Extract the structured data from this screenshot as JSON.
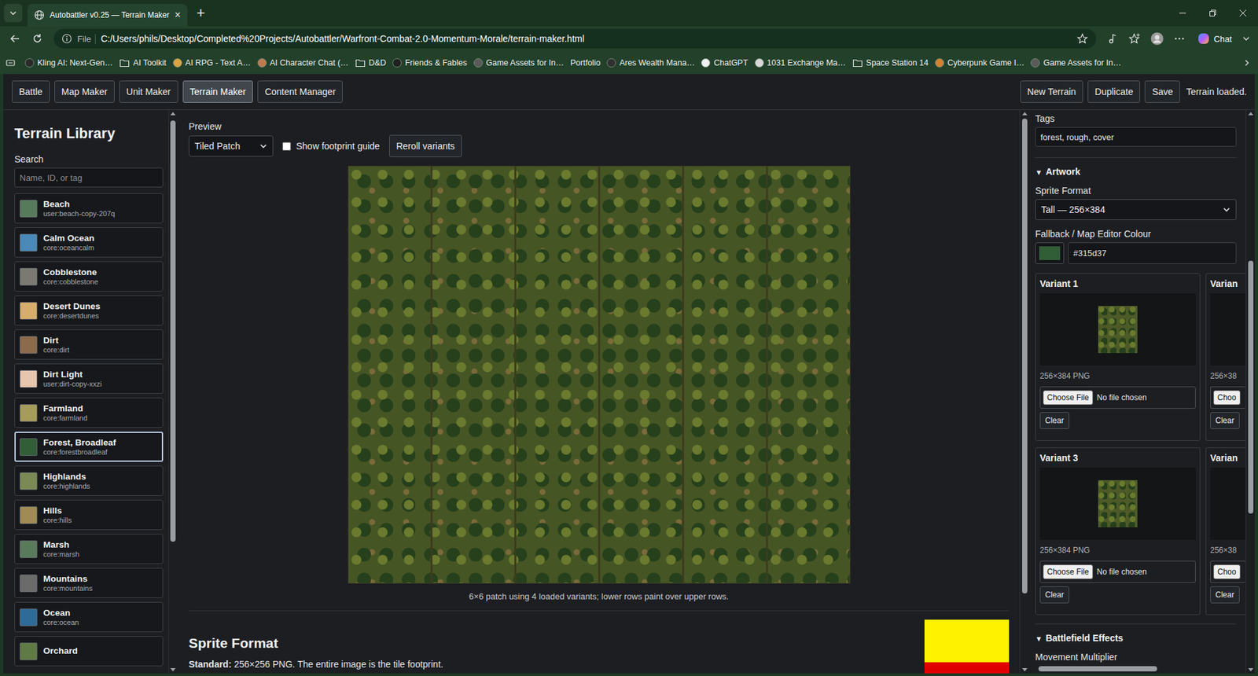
{
  "browser": {
    "tab_title": "Autobattler v0.25 — Terrain Maker",
    "tab_close": "×",
    "new_tab": "+",
    "address_scheme": "File",
    "url": "C:/Users/phils/Desktop/Completed%20Projects/Autobattler/Warfront-Combat-2.0-Momentum-Morale/terrain-maker.html",
    "copilot": "Chat"
  },
  "bookmarks": [
    {
      "label": "Kling AI: Next-Gen…",
      "kind": "site",
      "color": "#2a2a2a"
    },
    {
      "label": "AI Toolkit",
      "kind": "folder"
    },
    {
      "label": "AI RPG - Text A…",
      "kind": "site",
      "color": "#d9a441"
    },
    {
      "label": "AI Character Chat (…",
      "kind": "site",
      "color": "#c07a4e"
    },
    {
      "label": "D&D",
      "kind": "folder"
    },
    {
      "label": "Friends & Fables",
      "kind": "site",
      "color": "#202020"
    },
    {
      "label": "Game Assets for In…",
      "kind": "site",
      "color": "#5a5a5a"
    },
    {
      "label": "Portfolio",
      "kind": "plain"
    },
    {
      "label": "Ares Wealth Mana…",
      "kind": "site",
      "color": "#303030"
    },
    {
      "label": "ChatGPT",
      "kind": "site",
      "color": "#f0f0f0"
    },
    {
      "label": "1031 Exchange Ma…",
      "kind": "site",
      "color": "#d8d8d8"
    },
    {
      "label": "Space Station 14",
      "kind": "folder"
    },
    {
      "label": "Cyberpunk Game I…",
      "kind": "site",
      "color": "#d4822e"
    },
    {
      "label": "Game Assets for In…",
      "kind": "site",
      "color": "#5a5a5a"
    }
  ],
  "nav": {
    "tabs": [
      {
        "label": "Battle",
        "selected": false
      },
      {
        "label": "Map Maker",
        "selected": false
      },
      {
        "label": "Unit Maker",
        "selected": false
      },
      {
        "label": "Terrain Maker",
        "selected": true
      },
      {
        "label": "Content Manager",
        "selected": false
      }
    ],
    "actions": [
      "New Terrain",
      "Duplicate",
      "Save"
    ],
    "status": "Terrain loaded."
  },
  "library": {
    "title": "Terrain Library",
    "search_label": "Search",
    "search_placeholder": "Name, ID, or tag",
    "items": [
      {
        "name": "Beach",
        "id": "user:beach-copy-207q",
        "color": "#587a5c",
        "selected": false
      },
      {
        "name": "Calm Ocean",
        "id": "core:oceancalm",
        "color": "#4a8ab8",
        "selected": false
      },
      {
        "name": "Cobblestone",
        "id": "core:cobblestone",
        "color": "#7b7a72",
        "selected": false
      },
      {
        "name": "Desert Dunes",
        "id": "core:desertdunes",
        "color": "#d6ad6b",
        "selected": false
      },
      {
        "name": "Dirt",
        "id": "core:dirt",
        "color": "#8c6a4c",
        "selected": false
      },
      {
        "name": "Dirt Light",
        "id": "user:dirt-copy-xxzi",
        "color": "#e6c6ad",
        "selected": false
      },
      {
        "name": "Farmland",
        "id": "core:farmland",
        "color": "#a59c5a",
        "selected": false
      },
      {
        "name": "Forest, Broadleaf",
        "id": "core:forestbroadleaf",
        "color": "#315d37",
        "selected": true
      },
      {
        "name": "Highlands",
        "id": "core:highlands",
        "color": "#7b8a55",
        "selected": false
      },
      {
        "name": "Hills",
        "id": "core:hills",
        "color": "#a08b55",
        "selected": false
      },
      {
        "name": "Marsh",
        "id": "core:marsh",
        "color": "#5a7a5c",
        "selected": false
      },
      {
        "name": "Mountains",
        "id": "core:mountains",
        "color": "#6b6b6b",
        "selected": false
      },
      {
        "name": "Ocean",
        "id": "core:ocean",
        "color": "#2e6b98",
        "selected": false
      },
      {
        "name": "Orchard",
        "color": "#5f7a44",
        "selected": false
      }
    ]
  },
  "preview": {
    "label": "Preview",
    "mode": "Tiled Patch",
    "footprint_guide": {
      "label": "Show footprint guide",
      "checked": false
    },
    "reroll": "Reroll variants",
    "caption": "6×6 patch using 4 loaded variants; lower rows paint over upper rows."
  },
  "doc": {
    "heading": "Sprite Format",
    "term": "Standard:",
    "text": "256×256 PNG. The entire image is the tile footprint."
  },
  "editor": {
    "tags": {
      "label": "Tags",
      "value": "forest, rough, cover"
    },
    "artwork": {
      "toggle": "▼",
      "title": "Artwork",
      "expanded": true,
      "sprite_format_label": "Sprite Format",
      "sprite_format": "Tall — 256×384",
      "colour_label": "Fallback / Map Editor Colour",
      "colour": "#315d37",
      "variants": [
        {
          "title": "Variant 1",
          "image": true,
          "info": "256×384 PNG",
          "choose": "Choose File",
          "file": "No file chosen",
          "clear": "Clear"
        },
        {
          "title": "Varian",
          "image": false,
          "info": "256×38",
          "choose": "Choo",
          "clear": "Clear"
        },
        {
          "title": "Variant 3",
          "image": true,
          "info": "256×384 PNG",
          "choose": "Choose File",
          "file": "No file chosen",
          "clear": "Clear"
        },
        {
          "title": "Varian",
          "image": false,
          "info": "256×38",
          "choose": "Choo",
          "clear": "Clear"
        }
      ]
    },
    "battlefield": {
      "toggle": "▼",
      "title": "Battlefield Effects",
      "expanded": true,
      "field_label": "Movement Multiplier"
    }
  }
}
